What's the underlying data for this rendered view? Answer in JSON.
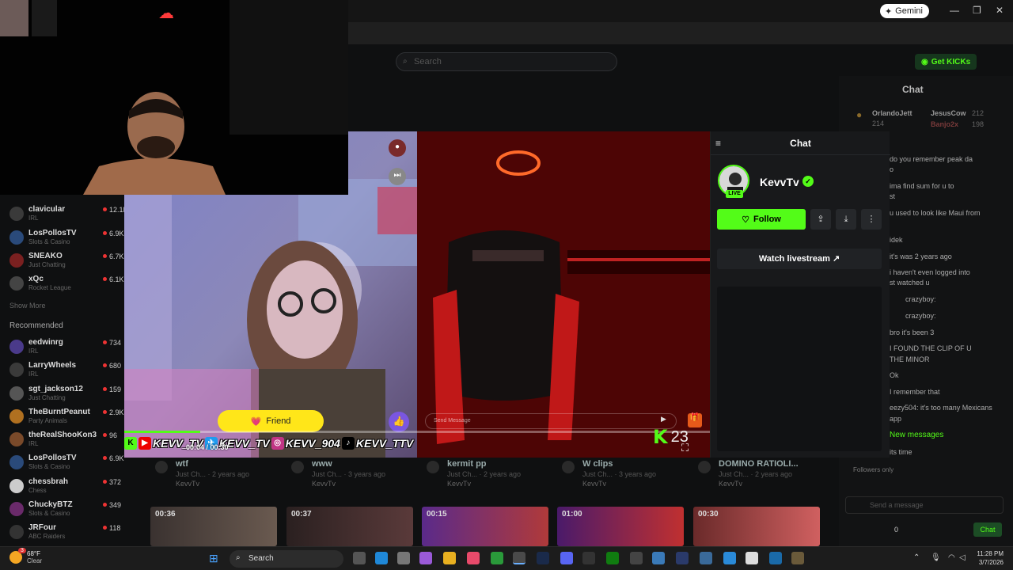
{
  "browser": {
    "gemini_label": "Gemini"
  },
  "site": {
    "search_placeholder": "Search",
    "get_kicks": "Get KICKs"
  },
  "sidebar": {
    "following": [
      {
        "name": "clavicular",
        "category": "IRL",
        "viewers": "12.1K"
      },
      {
        "name": "LosPollosTV",
        "category": "Slots & Casino",
        "viewers": "6.9K"
      },
      {
        "name": "SNEAKO",
        "category": "Just Chatting",
        "viewers": "6.7K"
      },
      {
        "name": "xQc",
        "category": "Rocket League",
        "viewers": "6.1K"
      }
    ],
    "show_more": "Show More",
    "recommended_heading": "Recommended",
    "recommended": [
      {
        "name": "eedwinrg",
        "category": "IRL",
        "viewers": "734"
      },
      {
        "name": "LarryWheels",
        "category": "IRL",
        "viewers": "680"
      },
      {
        "name": "sgt_jackson12",
        "category": "Just Chatting",
        "viewers": "159"
      },
      {
        "name": "TheBurntPeanut",
        "category": "Party Animals",
        "viewers": "2.9K"
      },
      {
        "name": "theRealShooKon3",
        "category": "IRL",
        "viewers": "96"
      },
      {
        "name": "LosPollosTV",
        "category": "Slots & Casino",
        "viewers": "6.9K"
      },
      {
        "name": "chessbrah",
        "category": "Chess",
        "viewers": "372"
      },
      {
        "name": "ChuckyBTZ",
        "category": "Slots & Casino",
        "viewers": "349"
      },
      {
        "name": "JRFour",
        "category": "ABC Raiders",
        "viewers": "118"
      }
    ]
  },
  "bg_chat": {
    "title": "Chat",
    "top_gifters": [
      {
        "name": "OrlandoJett",
        "count": "214"
      },
      {
        "name": "JesusCow",
        "count": "212"
      },
      {
        "name": "Banjo2x",
        "count": "198"
      }
    ],
    "messages": [
      "do you remember peak da",
      "o",
      "ima find sum for u to",
      "st",
      "u used to look like Maui from",
      "idek",
      "it's was 2 years ago",
      "i haven't even logged into",
      "st watched u",
      "crazyboy:",
      "crazyboy:",
      "bro it's been 3",
      "I FOUND THE CLIP OF U",
      "THE MINOR",
      "Ok",
      "I remember that",
      "eezy504: it's too many Mexicans",
      "app",
      "its time"
    ],
    "new_messages": "New messages",
    "followers_only": "Followers only",
    "send_placeholder": "Send a message",
    "chat_button": "Chat",
    "kicks_count": "0"
  },
  "videos": [
    {
      "title": "wtf",
      "meta": "Just Ch... · 2 years ago",
      "channel": "KevvTv"
    },
    {
      "title": "www",
      "meta": "Just Ch... · 3 years ago",
      "channel": "KevvTv"
    },
    {
      "title": "kermit pp",
      "meta": "Just Ch... · 2 years ago",
      "channel": "KevvTv"
    },
    {
      "title": "W clips",
      "meta": "Just Ch... · 3 years ago",
      "channel": "KevvTv"
    },
    {
      "title": "DOMINO RATIOLI...",
      "meta": "Just Ch... · 2 years ago",
      "channel": "KevvTv"
    }
  ],
  "clips": [
    {
      "duration": "00:36"
    },
    {
      "duration": "00:37"
    },
    {
      "duration": "00:15"
    },
    {
      "duration": "01:00"
    },
    {
      "duration": "00:30"
    }
  ],
  "player": {
    "friend_label": "Friend",
    "send_placeholder": "Send Message",
    "handles": [
      "KEVV_TV",
      "KEVV_TV",
      "KEVV_904",
      "KEVV_TTV"
    ],
    "timecode": "00:04 / 00:30",
    "progress": 0.13,
    "viewer_count": "23"
  },
  "chat_panel": {
    "title": "Chat",
    "streamer": "KevvTv",
    "live_badge": "LIVE",
    "follow_label": "Follow",
    "watch_label": "Watch livestream"
  },
  "taskbar": {
    "temp": "68°F",
    "condition": "Clear",
    "search_label": "Search",
    "time": "11:28 PM",
    "date": "3/7/2026",
    "weather_badge": "3"
  }
}
